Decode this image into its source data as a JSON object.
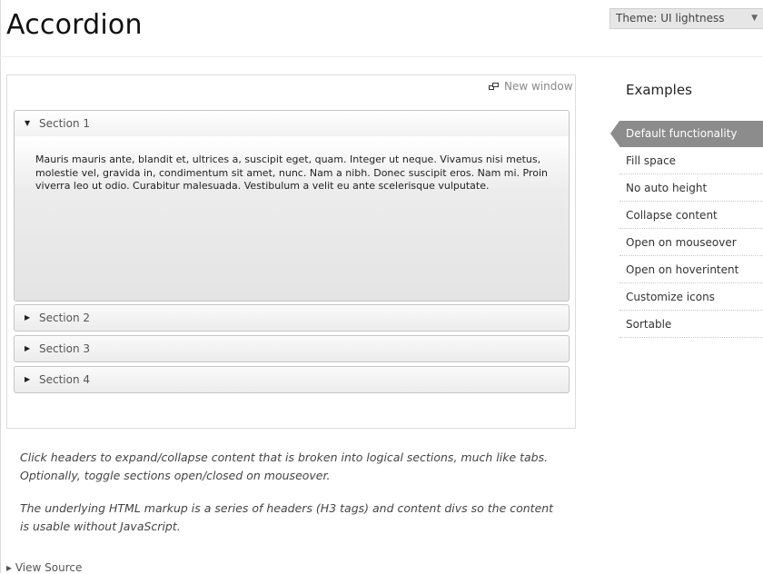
{
  "header": {
    "title": "Accordion",
    "theme_select_value": "Theme: UI lightness"
  },
  "demo": {
    "new_window_label": "New window",
    "sections": [
      {
        "label": "Section 1",
        "expanded": true
      },
      {
        "label": "Section 2",
        "expanded": false
      },
      {
        "label": "Section 3",
        "expanded": false
      },
      {
        "label": "Section 4",
        "expanded": false
      }
    ],
    "section1_content": "Mauris mauris ante, blandit et, ultrices a, suscipit eget, quam. Integer ut neque. Vivamus nisi metus, molestie vel, gravida in, condimentum sit amet, nunc. Nam a nibh. Donec suscipit eros. Nam mi. Proin viverra leo ut odio. Curabitur malesuada. Vestibulum a velit eu ante scelerisque vulputate."
  },
  "description": {
    "p1": "Click headers to expand/collapse content that is broken into logical sections, much like tabs. Optionally, toggle sections open/closed on mouseover.",
    "p2": "The underlying HTML markup is a series of headers (H3 tags) and content divs so the content is usable without JavaScript.",
    "view_source": "View Source"
  },
  "examples": {
    "title": "Examples",
    "items": [
      {
        "label": "Default functionality",
        "active": true
      },
      {
        "label": "Fill space",
        "active": false
      },
      {
        "label": "No auto height",
        "active": false
      },
      {
        "label": "Collapse content",
        "active": false
      },
      {
        "label": "Open on mouseover",
        "active": false
      },
      {
        "label": "Open on hoverintent",
        "active": false
      },
      {
        "label": "Customize icons",
        "active": false
      },
      {
        "label": "Sortable",
        "active": false
      }
    ]
  },
  "colors": {
    "active_example_bg": "#8c8c8c",
    "header_border": "#c5c5c5"
  },
  "icons": {
    "expanded": "triangle-down-icon",
    "collapsed": "triangle-right-icon",
    "new_window": "new-window-icon",
    "select_caret": "chevron-down-icon"
  }
}
